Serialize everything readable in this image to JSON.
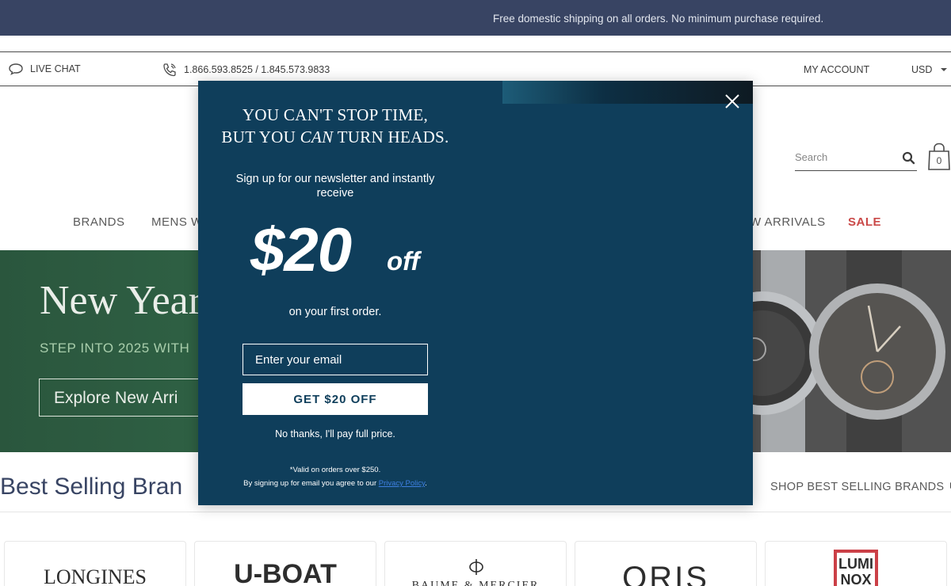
{
  "announcement": "Free domestic shipping on all orders. No minimum purchase required.",
  "utility": {
    "live_chat": "LIVE CHAT",
    "phones": "1.866.593.8525 / 1.845.573.9833",
    "my_account": "MY ACCOUNT",
    "currency": "USD"
  },
  "search": {
    "placeholder": "Search"
  },
  "cart": {
    "count": "0"
  },
  "nav": {
    "brands": "BRANDS",
    "mens": "MENS W",
    "new_arrivals": "W ARRIVALS",
    "sale": "SALE"
  },
  "hero": {
    "title": "New Year",
    "subtitle": "STEP INTO 2025 WITH",
    "button": "Explore New Arri"
  },
  "best_selling": {
    "title": "Best Selling Bran",
    "link": "SHOP BEST SELLING BRANDS"
  },
  "brands": [
    "LONGINES",
    "U-BOAT",
    "BAUME & MERCIER",
    "ORIS",
    "LUMINOX"
  ],
  "modal": {
    "headline_line1": "YOU CAN'T STOP TIME,",
    "headline_line2_pre": "BUT YOU ",
    "headline_line2_em": "CAN",
    "headline_line2_post": " TURN HEADS.",
    "lead": "Sign up for our newsletter and instantly receive",
    "amount": "$20",
    "off": "off",
    "first_order": "on your first order.",
    "email_placeholder": "Enter your email",
    "cta": "GET $20 OFF",
    "no_thanks": "No thanks, I'll pay full price.",
    "fine_print_1": "*Valid on orders over $250.",
    "fine_print_2": "By signing up for email you agree to our ",
    "privacy_link": "Privacy Policy",
    "fine_print_end": "."
  },
  "colors": {
    "announcement_bg": "#1d2b4e",
    "modal_bg": "#0f3e5b",
    "sale": "#c3302f",
    "hero_bg": "#1a5a33"
  }
}
